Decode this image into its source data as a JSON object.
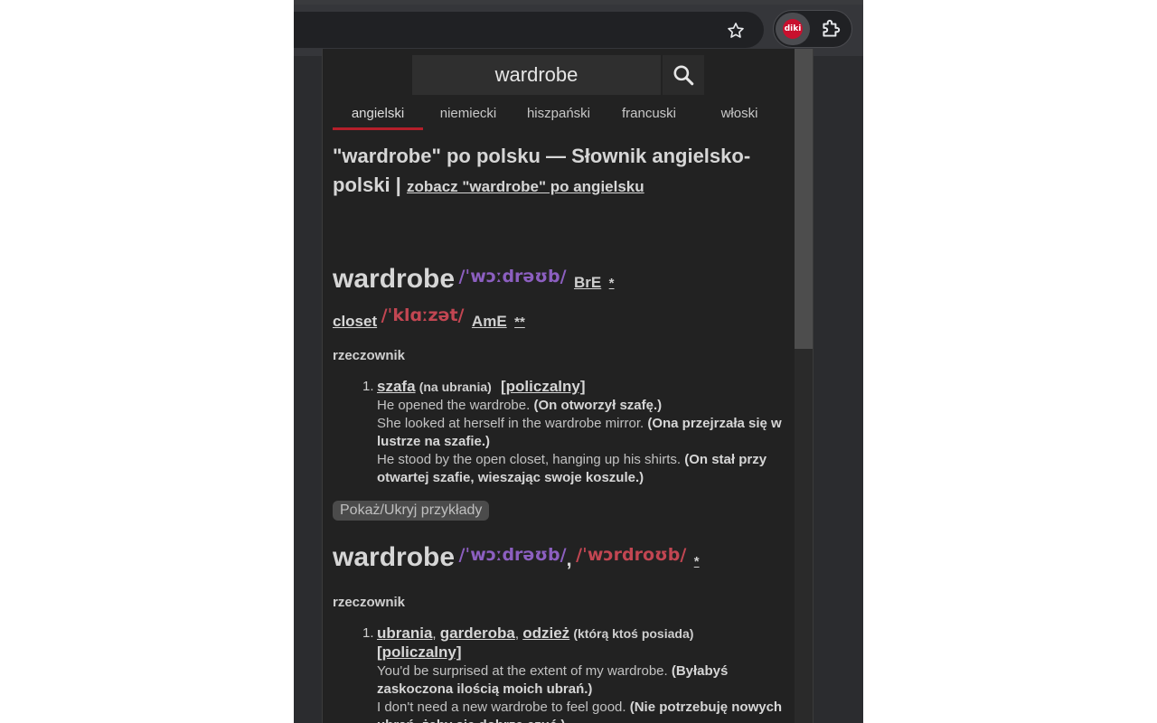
{
  "browser": {
    "star_icon": "star-outline-icon",
    "extensions": [
      {
        "name": "diki",
        "badge_text": "diki",
        "color": "#c8102e"
      },
      {
        "name": "extensions-puzzle",
        "icon": "puzzle-icon"
      }
    ]
  },
  "popup": {
    "search": {
      "value": "wardrobe",
      "icon": "magnifier-icon"
    },
    "tabs": [
      {
        "label": "angielski",
        "active": true
      },
      {
        "label": "niemiecki"
      },
      {
        "label": "hiszpański"
      },
      {
        "label": "francuski"
      },
      {
        "label": "włoski"
      }
    ],
    "heading": {
      "main": "\"wardrobe\" po polsku — Słownik angielsko-polski |",
      "link": "zobacz \"wardrobe\" po angielsku"
    },
    "entry1": {
      "headword": "wardrobe",
      "ipa_bre": "/ˈwɔːdrəʊb/",
      "region_bre": "BrE",
      "star": "*",
      "alt_word": "closet",
      "ipa_ame": "/ˈklɑːzət/",
      "region_ame": "AmE",
      "alt_star": "**",
      "pos": "rzeczownik",
      "meaning": {
        "num": "1.",
        "translation": "szafa",
        "note": "(na ubrania)",
        "tag": "[policzalny]",
        "examples": [
          {
            "en": "He opened the wardrobe.",
            "pl": "(On otworzył szafę.)"
          },
          {
            "en": "She looked at herself in the wardrobe mirror.",
            "pl": "(Ona przejrzała się w lustrze na szafie.)"
          },
          {
            "en": "He stood by the open closet, hanging up his shirts.",
            "pl": "(On stał przy otwartej szafie, wieszając swoje koszule.)"
          }
        ]
      }
    },
    "toggle_label": "Pokaż/Ukryj przykłady",
    "entry2": {
      "headword": "wardrobe",
      "ipa_bre": "/ˈwɔːdrəʊb/",
      "comma": ",",
      "ipa_ame": "/ˈwɔrdroʊb/",
      "star": "*",
      "pos": "rzeczownik",
      "meaning": {
        "num": "1.",
        "translations": [
          "ubrania",
          "garderoba",
          "odzież"
        ],
        "note": "(którą ktoś posiada)",
        "tag": "[policzalny]",
        "examples": [
          {
            "en": "You'd be surprised at the extent of my wardrobe.",
            "pl": "(Byłabyś zaskoczona ilością moich ubrań.)"
          },
          {
            "en": "I don't need a new wardrobe to feel good.",
            "pl": "(Nie potrzebuję nowych ubrań, żeby się dobrze czuć.)"
          }
        ]
      }
    }
  }
}
